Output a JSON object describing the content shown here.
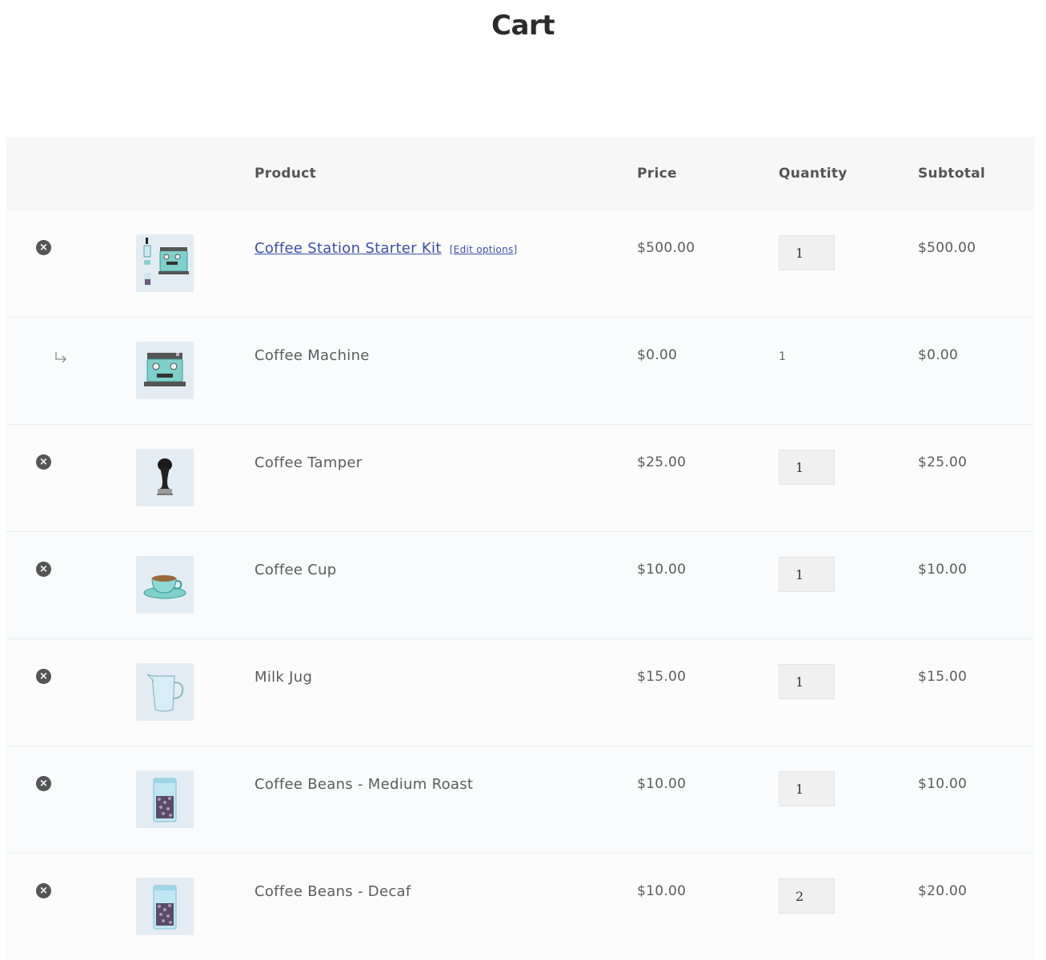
{
  "page": {
    "title": "Cart"
  },
  "columns": {
    "product": "Product",
    "price": "Price",
    "quantity": "Quantity",
    "subtotal": "Subtotal"
  },
  "items": [
    {
      "name": "Coffee Station Starter Kit",
      "edit": "[Edit options]",
      "price": "$500.00",
      "quantity": "1",
      "subtotal": "$500.00",
      "icon": "starter-kit-icon"
    },
    {
      "name": "Coffee Machine",
      "price": "$0.00",
      "quantity": "1",
      "subtotal": "$0.00",
      "icon": "coffee-machine-icon"
    },
    {
      "name": "Coffee Tamper",
      "price": "$25.00",
      "quantity": "1",
      "subtotal": "$25.00",
      "icon": "tamper-icon"
    },
    {
      "name": "Coffee Cup",
      "price": "$10.00",
      "quantity": "1",
      "subtotal": "$10.00",
      "icon": "coffee-cup-icon"
    },
    {
      "name": "Milk Jug",
      "price": "$15.00",
      "quantity": "1",
      "subtotal": "$15.00",
      "icon": "milk-jug-icon"
    },
    {
      "name": "Coffee Beans - Medium Roast",
      "price": "$10.00",
      "quantity": "1",
      "subtotal": "$10.00",
      "icon": "coffee-beans-bag-icon"
    },
    {
      "name": "Coffee Beans - Decaf",
      "price": "$10.00",
      "quantity": "2",
      "subtotal": "$20.00",
      "icon": "coffee-beans-bag-icon"
    }
  ],
  "icons": {
    "remove": "remove-circle-icon",
    "child": "child-arrow-icon"
  },
  "colors": {
    "link": "#3b4fa8",
    "header_bg": "#f7f7f7",
    "thumb_bg": "#e4ecf3"
  }
}
